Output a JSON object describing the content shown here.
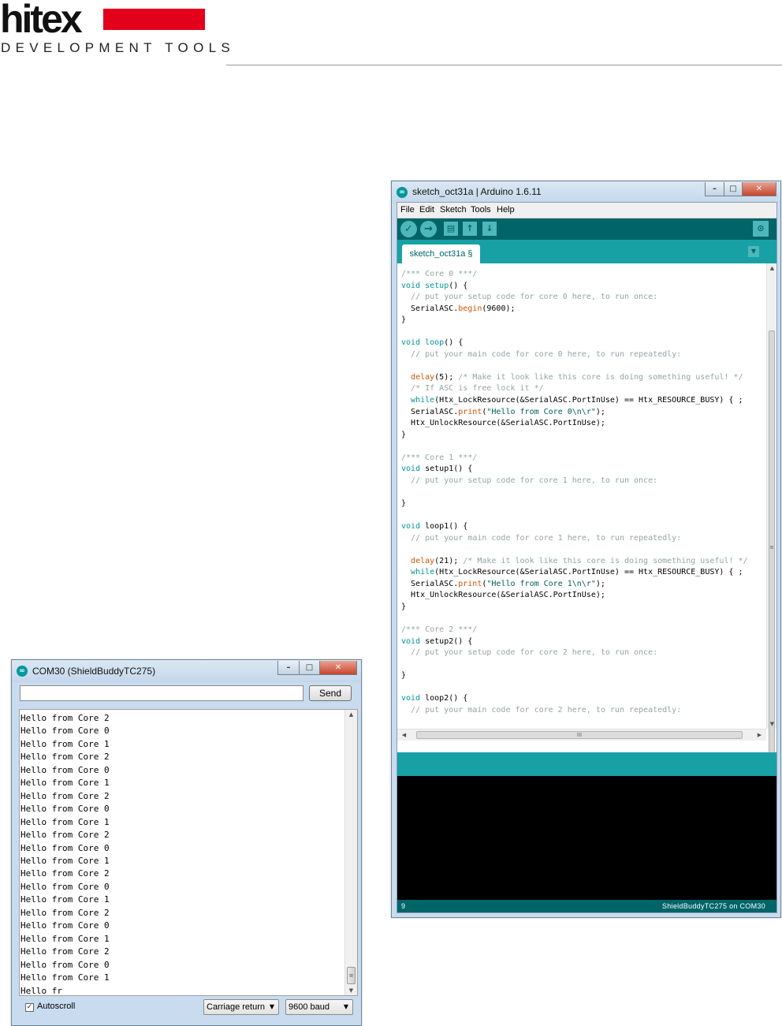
{
  "brand": {
    "logo_word": "hitex",
    "tagline": "DEVELOPMENT TOOLS",
    "accent_color": "#e3001b"
  },
  "ide": {
    "title": "sketch_oct31a | Arduino 1.6.11",
    "menu": [
      "File",
      "Edit",
      "Sketch",
      "Tools",
      "Help"
    ],
    "toolbar_icons": [
      "verify-icon",
      "upload-icon",
      "new-icon",
      "open-icon",
      "save-icon",
      "serial-monitor-icon"
    ],
    "tab_label": "sketch_oct31a §",
    "scroll_grip": "≡",
    "hscroll_grip": "III",
    "line_number": "9",
    "board_status": "ShieldBuddyTC275 on COM30",
    "colors": {
      "teal_dark": "#006468",
      "teal": "#17a1a5",
      "keyword": "#00979c",
      "function": "#d35400",
      "comment": "#95a5a6"
    }
  },
  "serial": {
    "title": "COM30 (ShieldBuddyTC275)",
    "input_value": "",
    "send_label": "Send",
    "lines": [
      "Hello from Core 2",
      "Hello from Core 0",
      "Hello from Core 1",
      "Hello from Core 2",
      "Hello from Core 0",
      "Hello from Core 1",
      "Hello from Core 2",
      "Hello from Core 0",
      "Hello from Core 1",
      "Hello from Core 2",
      "Hello from Core 0",
      "Hello from Core 1",
      "Hello from Core 2",
      "Hello from Core 0",
      "Hello from Core 1",
      "Hello from Core 2",
      "Hello from Core 0",
      "Hello from Core 1",
      "Hello from Core 2",
      "Hello from Core 0",
      "Hello from Core 1",
      "Hello fr"
    ],
    "autoscroll_label": "Autoscroll",
    "autoscroll_checked": true,
    "line_ending": "Carriage return",
    "baud": "9600 baud"
  }
}
